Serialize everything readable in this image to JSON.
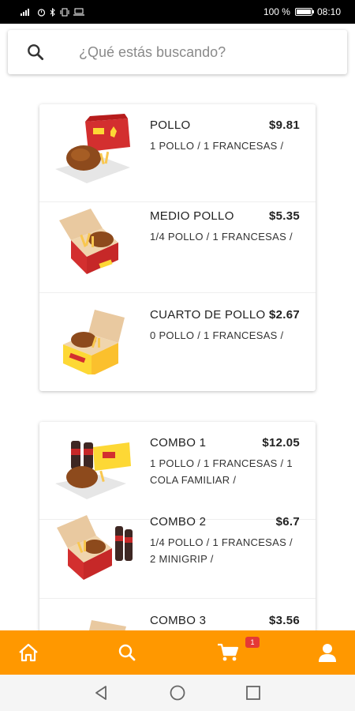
{
  "status_bar": {
    "battery_text": "100 %",
    "time": "08:10"
  },
  "search": {
    "placeholder": "¿Qué estás buscando?"
  },
  "sections": [
    {
      "items": [
        {
          "name": "POLLO",
          "price": "$9.81",
          "description": "1 POLLO / 1 FRANCESAS /"
        },
        {
          "name": "MEDIO POLLO",
          "price": "$5.35",
          "description": "1/4 POLLO / 1 FRANCESAS /"
        },
        {
          "name": "CUARTO DE POLLO",
          "price": "$2.67",
          "description": "0 POLLO / 1 FRANCESAS /"
        }
      ]
    },
    {
      "items": [
        {
          "name": "COMBO 1",
          "price": "$12.05",
          "description": "1 POLLO / 1 FRANCESAS / 1 COLA FAMILIAR /"
        },
        {
          "name": "COMBO 2",
          "price": "$6.7",
          "description": "1/4 POLLO / 1 FRANCESAS / 2 MINIGRIP /"
        },
        {
          "name": "COMBO 3",
          "price": "$3.56",
          "description": ""
        }
      ]
    }
  ],
  "bottom_nav": {
    "items": [
      {
        "icon": "home-icon"
      },
      {
        "icon": "search-icon"
      },
      {
        "icon": "cart-icon"
      },
      {
        "icon": "user-icon"
      }
    ],
    "cart_badge": "1"
  },
  "colors": {
    "accent": "#ff9800",
    "badge": "#e53935"
  }
}
